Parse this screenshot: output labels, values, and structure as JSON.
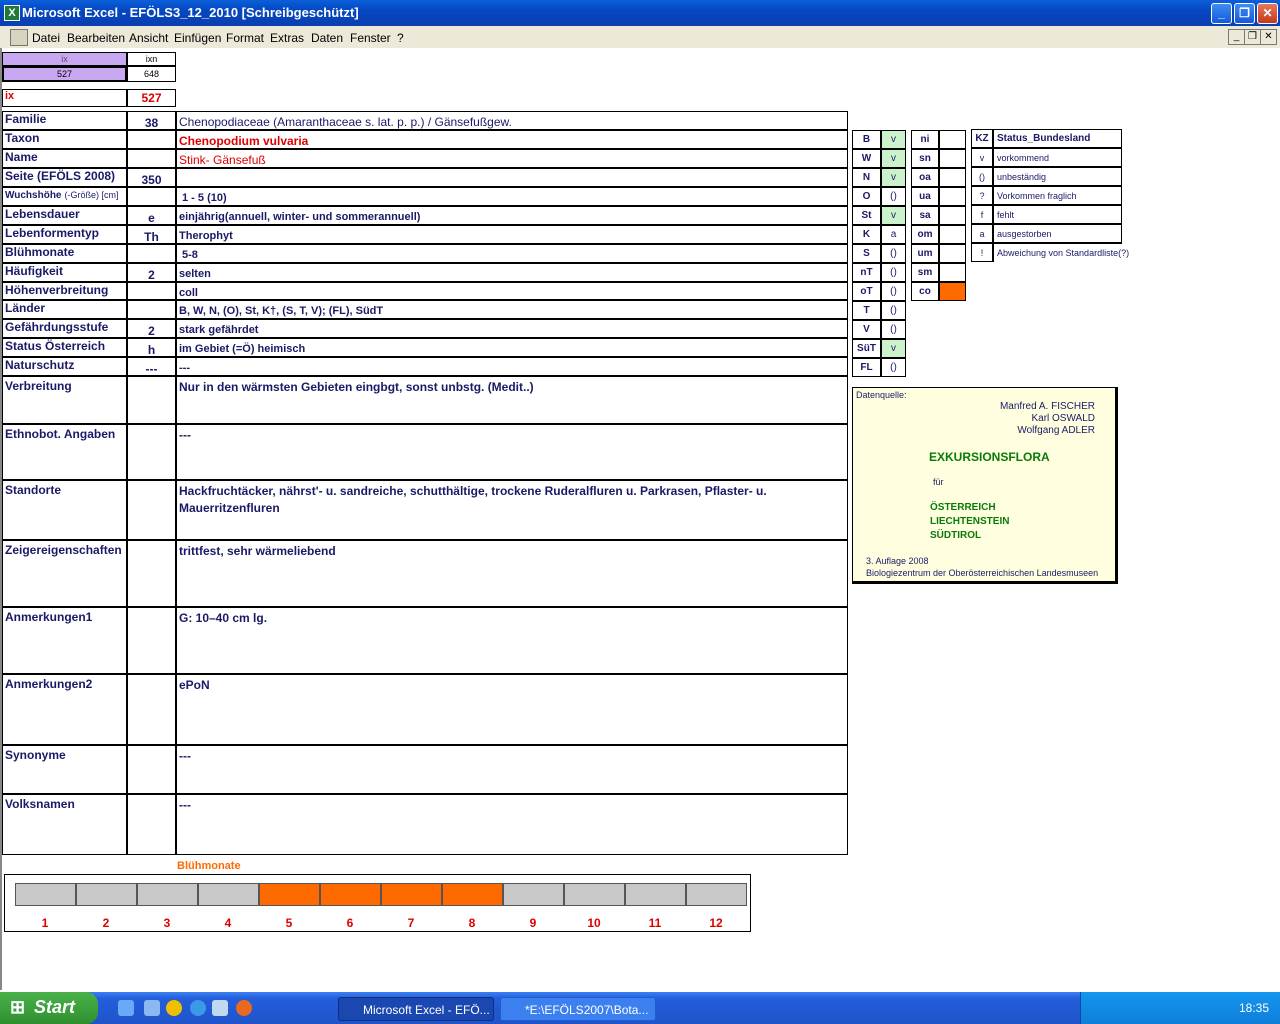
{
  "window": {
    "title": "Microsoft Excel - EFÖLS3_12_2010  [Schreibgeschützt]"
  },
  "menu": [
    "Datei",
    "Bearbeiten",
    "Ansicht",
    "Einfügen",
    "Format",
    "Extras",
    "Daten",
    "Fenster",
    "?"
  ],
  "ix_header": {
    "ix": "ix",
    "ixn": "ixn",
    "ix_val": "527",
    "ixn_val": "648"
  },
  "ix_row": {
    "label": "ix",
    "value": "527"
  },
  "rows": [
    {
      "label": "Familie",
      "num": "38",
      "value": "Chenopodiaceae (Amaranthaceae s. lat. p. p.)  /  Gänsefußgew."
    },
    {
      "label": "Taxon",
      "num": "",
      "value": "Chenopodium vulvaria"
    },
    {
      "label": "Name",
      "num": "",
      "value": "Stink- Gänsefuß"
    },
    {
      "label": "Seite (EFÖLS 2008)",
      "num": "350",
      "value": ""
    },
    {
      "label": "Wuchshöhe",
      "label2": "(-Größe) [cm]",
      "num": "",
      "value": "1 - 5 (10)"
    },
    {
      "label": "Lebensdauer",
      "num": "e",
      "value": "einjährig(annuell, winter- und sommerannuell)"
    },
    {
      "label": "Lebenformentyp",
      "num": "Th",
      "value": "Therophyt"
    },
    {
      "label": "Blühmonate",
      "num": "",
      "value": "5-8"
    },
    {
      "label": "Häufigkeit",
      "num": "2",
      "value": "selten"
    },
    {
      "label": "Höhenverbreitung",
      "num": "",
      "value": "coll"
    },
    {
      "label": "Länder",
      "num": "",
      "value": "B, W, N, (O), St, K†, (S, T, V); (FL), SüdT"
    },
    {
      "label": "Gefährdungsstufe",
      "num": "2",
      "value": "stark gefährdet"
    },
    {
      "label": "Status Österreich",
      "num": "h",
      "value": "im Gebiet (=Ö) heimisch"
    },
    {
      "label": "Naturschutz",
      "num": "---",
      "value": "---"
    }
  ],
  "big_rows": [
    {
      "label": "Verbreitung",
      "value": "Nur in den wärmsten Gebieten eingbgt, sonst unbstg. (Medit..)"
    },
    {
      "label": "Ethnobot. Angaben",
      "value": "---"
    },
    {
      "label": "Standorte",
      "value": "Hackfruchtäcker, nährst'- u. sandreiche, schutthältige, trockene Ruderalfluren u. Parkrasen, Pflaster- u. Mauerritzenfluren"
    },
    {
      "label": "Zeigereigenschaften",
      "value": " trittfest, sehr wärmeliebend"
    },
    {
      "label": "Anmerkungen1",
      "value": "G: 10–40 cm lg."
    },
    {
      "label": "Anmerkungen2",
      "value": "ePoN"
    },
    {
      "label": "Synonyme",
      "value": "---"
    },
    {
      "label": "Volksnamen",
      "value": "---"
    }
  ],
  "states": [
    {
      "code": "B",
      "val": "v",
      "green": true
    },
    {
      "code": "W",
      "val": "v",
      "green": true
    },
    {
      "code": "N",
      "val": "v",
      "green": true
    },
    {
      "code": "O",
      "val": "()",
      "green": false
    },
    {
      "code": "St",
      "val": "v",
      "green": true
    },
    {
      "code": "K",
      "val": "a",
      "green": false
    },
    {
      "code": "S",
      "val": "()",
      "green": false
    },
    {
      "code": "nT",
      "val": "()",
      "green": false
    },
    {
      "code": "oT",
      "val": "()",
      "green": false
    },
    {
      "code": "T",
      "val": "()",
      "green": false
    },
    {
      "code": "V",
      "val": "()",
      "green": false
    },
    {
      "code": "SüT",
      "val": "v",
      "green": true
    },
    {
      "code": "FL",
      "val": "()",
      "green": false
    }
  ],
  "altitude": [
    {
      "code": "ni",
      "orange": false
    },
    {
      "code": "sn",
      "orange": false
    },
    {
      "code": "oa",
      "orange": false
    },
    {
      "code": "ua",
      "orange": false
    },
    {
      "code": "sa",
      "orange": false
    },
    {
      "code": "om",
      "orange": false
    },
    {
      "code": "um",
      "orange": false
    },
    {
      "code": "sm",
      "orange": false
    },
    {
      "code": "co",
      "orange": true
    }
  ],
  "kz": {
    "head_kz": "KZ",
    "head_status": "Status_Bundesland",
    "items": [
      {
        "kz": "v",
        "text": "vorkommend"
      },
      {
        "kz": "()",
        "text": "unbeständig"
      },
      {
        "kz": "?",
        "text": "Vorkommen fraglich"
      },
      {
        "kz": "f",
        "text": "fehlt"
      },
      {
        "kz": "a",
        "text": "ausgestorben"
      },
      {
        "kz": "!",
        "text": "Abweichung von Standardliste(?)"
      }
    ]
  },
  "book": {
    "source": "Datenquelle:",
    "authors": [
      "Manfred A. FISCHER",
      "Karl OSWALD",
      "Wolfgang ADLER"
    ],
    "title": "EXKURSIONSFLORA",
    "fuer": "für",
    "countries": [
      "ÖSTERREICH",
      "LIECHTENSTEIN",
      "SÜDTIROL"
    ],
    "edition": "3. Auflage 2008",
    "publisher": "Biologiezentrum der Oberösterreichischen Landesmuseen"
  },
  "months": {
    "title": "Blühmonate",
    "labels": [
      "1",
      "2",
      "3",
      "4",
      "5",
      "6",
      "7",
      "8",
      "9",
      "10",
      "11",
      "12"
    ],
    "flowering": [
      false,
      false,
      false,
      false,
      true,
      true,
      true,
      true,
      false,
      false,
      false,
      false
    ],
    "colors": {
      "on": "#ff6a00",
      "off": "#c8c8c8"
    }
  },
  "taskbar": {
    "start": "Start",
    "tasks": [
      "Microsoft Excel - EFÖ...",
      "*E:\\EFÖLS2007\\Bota..."
    ],
    "clock": "18:35"
  }
}
